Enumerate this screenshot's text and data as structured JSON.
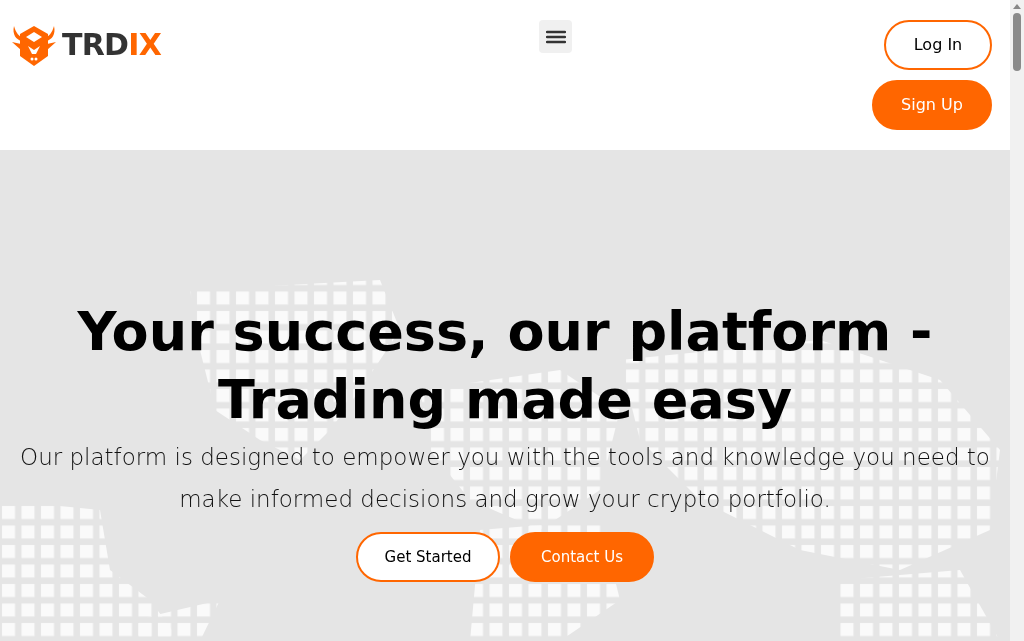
{
  "header": {
    "logo": {
      "dark_part": "TRD",
      "accent_part": "IX"
    },
    "buttons": [
      {
        "label": "Log In",
        "kind": "outline"
      },
      {
        "label": "Sign Up",
        "kind": "filled"
      }
    ]
  },
  "hero": {
    "headline_lines": [
      "Your success, our platform -",
      "Trading made easy"
    ],
    "subtitle": "Our platform is designed to empower you with the tools and knowledge you need to make informed decisions and grow your crypto portfolio.",
    "buttons": [
      {
        "label": "Get Started",
        "kind": "outline"
      },
      {
        "label": "Contact Us",
        "kind": "filled"
      }
    ]
  }
}
